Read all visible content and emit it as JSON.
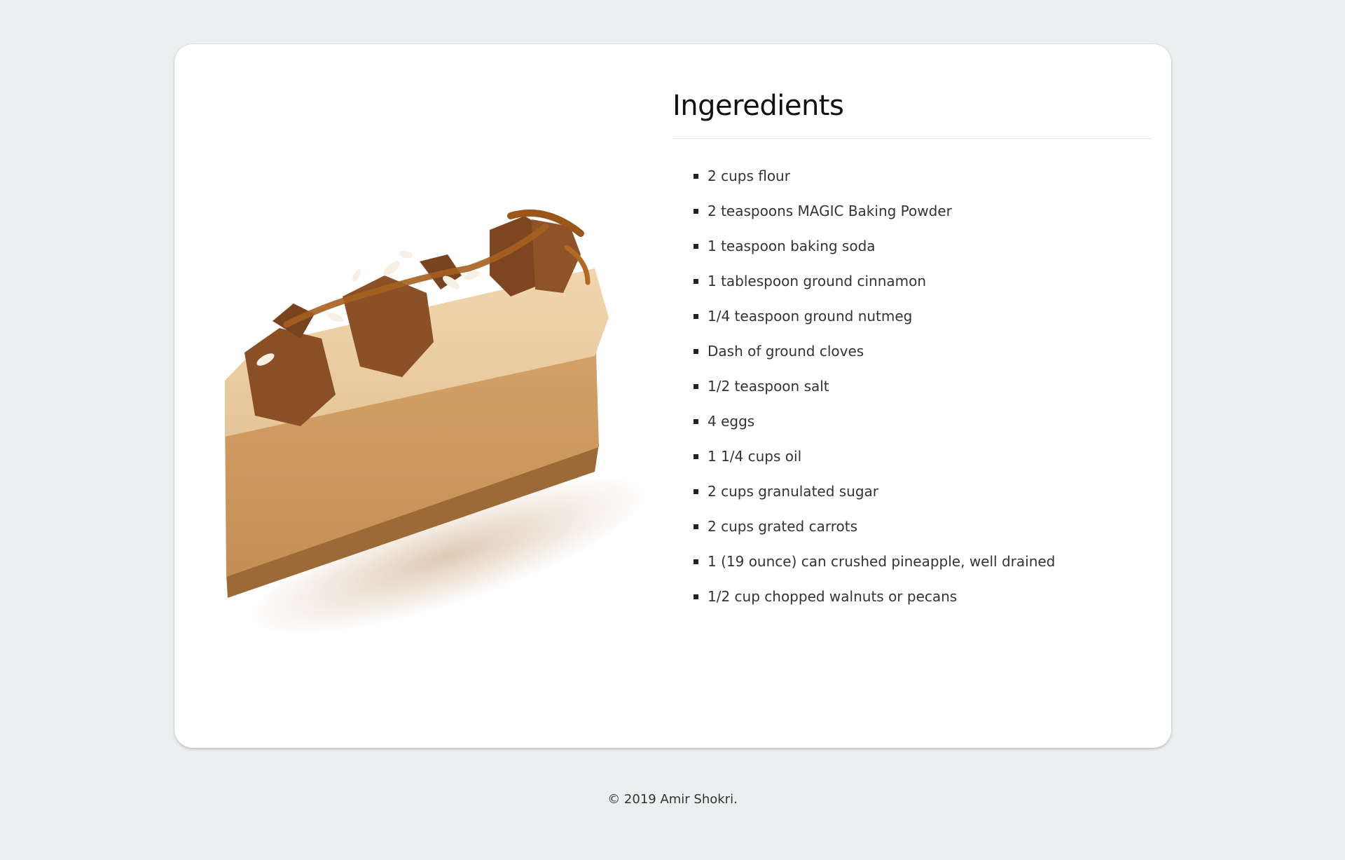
{
  "page": {
    "background": "#ebeff0",
    "card_background": "#ffffff"
  },
  "recipe": {
    "title": "Ingeredients",
    "image": {
      "alt": "slice of caramel cheesecake with cookie crumbs",
      "icon": "cheesecake-image"
    },
    "ingredients": [
      "2 cups flour",
      "2 teaspoons MAGIC Baking Powder",
      "1 teaspoon baking soda",
      "1 tablespoon ground cinnamon",
      "1/4 teaspoon ground nutmeg",
      "Dash of ground cloves",
      "1/2 teaspoon salt",
      "4 eggs",
      "1 1/4 cups oil",
      "2 cups granulated sugar",
      "2 cups grated carrots",
      "1 (19 ounce) can crushed pineapple, well drained",
      "1/2 cup chopped walnuts or pecans"
    ]
  },
  "footer": {
    "text": "© 2019 Amir Shokri."
  }
}
